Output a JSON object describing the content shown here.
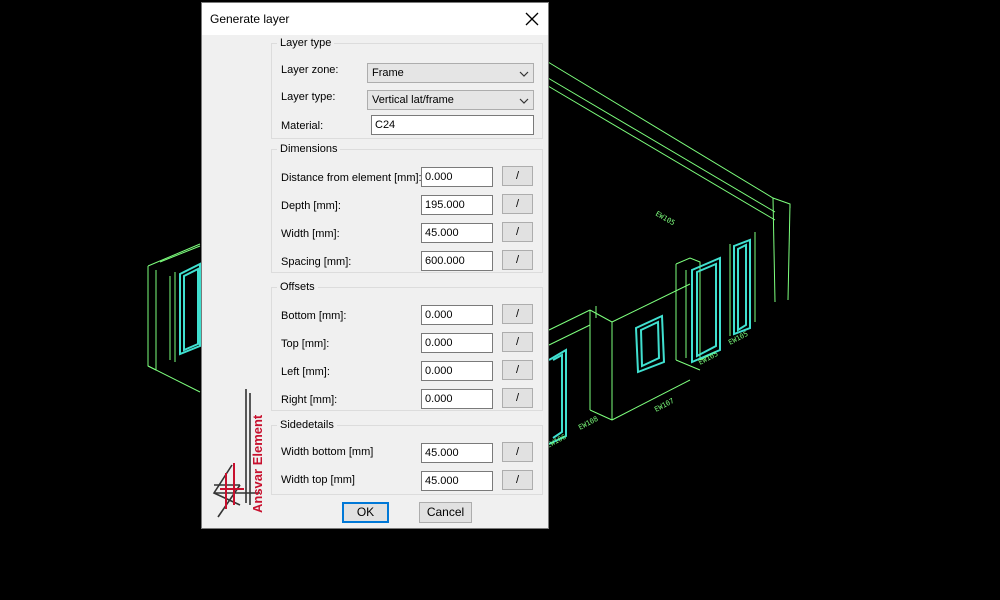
{
  "dialog": {
    "title": "Generate layer",
    "close_glyph": "×",
    "logo": {
      "text": "Ansvar Element",
      "brand_color": "#c8102e"
    }
  },
  "layer_type": {
    "legend": "Layer type",
    "zone_label": "Layer zone:",
    "zone_value": "Frame",
    "type_label": "Layer type:",
    "type_value": "Vertical lat/frame",
    "material_label": "Material:",
    "material_value": "C24"
  },
  "dimensions": {
    "legend": "Dimensions",
    "rows": [
      {
        "label": "Distance from element [mm]:",
        "value": "0.000",
        "button": "/"
      },
      {
        "label": "Depth [mm]:",
        "value": "195.000",
        "button": "/"
      },
      {
        "label": "Width [mm]:",
        "value": "45.000",
        "button": "/"
      },
      {
        "label": "Spacing [mm]:",
        "value": "600.000",
        "button": "/"
      }
    ]
  },
  "offsets": {
    "legend": "Offsets",
    "rows": [
      {
        "label": "Bottom [mm]:",
        "value": "0.000",
        "button": "/"
      },
      {
        "label": "Top [mm]:",
        "value": "0.000",
        "button": "/"
      },
      {
        "label": "Left [mm]:",
        "value": "0.000",
        "button": "/"
      },
      {
        "label": "Right [mm]:",
        "value": "0.000",
        "button": "/"
      }
    ]
  },
  "sidedetails": {
    "legend": "Sidedetails",
    "rows": [
      {
        "label": "Width bottom [mm]",
        "value": "45.000",
        "button": "/"
      },
      {
        "label": "Width top [mm]",
        "value": "45.000",
        "button": "/"
      }
    ]
  },
  "footer": {
    "ok_label": "OK",
    "cancel_label": "Cancel"
  },
  "colors": {
    "cad_background": "#000000",
    "cad_lines": "#7dff7d",
    "cad_openings": "#40e0d0",
    "dialog_background": "#f0f0f0",
    "focus_accent": "#0078d7"
  },
  "icons": {
    "close": "close-icon",
    "dropdown": "chevron-down-icon",
    "logo": "ansvar-element-logo"
  }
}
